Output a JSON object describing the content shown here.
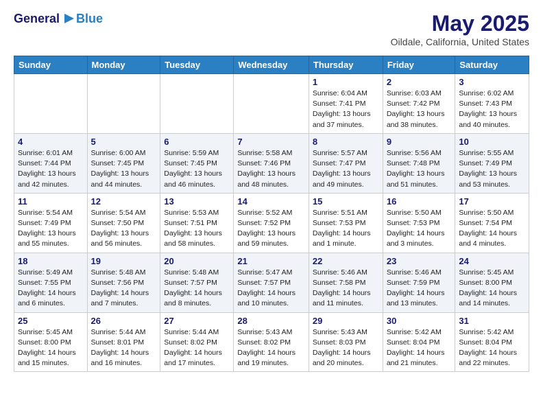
{
  "header": {
    "logo_general": "General",
    "logo_blue": "Blue",
    "month_title": "May 2025",
    "location": "Oildale, California, United States"
  },
  "weekdays": [
    "Sunday",
    "Monday",
    "Tuesday",
    "Wednesday",
    "Thursday",
    "Friday",
    "Saturday"
  ],
  "weeks": [
    [
      {
        "day": "",
        "sunrise": "",
        "sunset": "",
        "daylight": ""
      },
      {
        "day": "",
        "sunrise": "",
        "sunset": "",
        "daylight": ""
      },
      {
        "day": "",
        "sunrise": "",
        "sunset": "",
        "daylight": ""
      },
      {
        "day": "",
        "sunrise": "",
        "sunset": "",
        "daylight": ""
      },
      {
        "day": "1",
        "sunrise": "Sunrise: 6:04 AM",
        "sunset": "Sunset: 7:41 PM",
        "daylight": "Daylight: 13 hours and 37 minutes."
      },
      {
        "day": "2",
        "sunrise": "Sunrise: 6:03 AM",
        "sunset": "Sunset: 7:42 PM",
        "daylight": "Daylight: 13 hours and 38 minutes."
      },
      {
        "day": "3",
        "sunrise": "Sunrise: 6:02 AM",
        "sunset": "Sunset: 7:43 PM",
        "daylight": "Daylight: 13 hours and 40 minutes."
      }
    ],
    [
      {
        "day": "4",
        "sunrise": "Sunrise: 6:01 AM",
        "sunset": "Sunset: 7:44 PM",
        "daylight": "Daylight: 13 hours and 42 minutes."
      },
      {
        "day": "5",
        "sunrise": "Sunrise: 6:00 AM",
        "sunset": "Sunset: 7:45 PM",
        "daylight": "Daylight: 13 hours and 44 minutes."
      },
      {
        "day": "6",
        "sunrise": "Sunrise: 5:59 AM",
        "sunset": "Sunset: 7:45 PM",
        "daylight": "Daylight: 13 hours and 46 minutes."
      },
      {
        "day": "7",
        "sunrise": "Sunrise: 5:58 AM",
        "sunset": "Sunset: 7:46 PM",
        "daylight": "Daylight: 13 hours and 48 minutes."
      },
      {
        "day": "8",
        "sunrise": "Sunrise: 5:57 AM",
        "sunset": "Sunset: 7:47 PM",
        "daylight": "Daylight: 13 hours and 49 minutes."
      },
      {
        "day": "9",
        "sunrise": "Sunrise: 5:56 AM",
        "sunset": "Sunset: 7:48 PM",
        "daylight": "Daylight: 13 hours and 51 minutes."
      },
      {
        "day": "10",
        "sunrise": "Sunrise: 5:55 AM",
        "sunset": "Sunset: 7:49 PM",
        "daylight": "Daylight: 13 hours and 53 minutes."
      }
    ],
    [
      {
        "day": "11",
        "sunrise": "Sunrise: 5:54 AM",
        "sunset": "Sunset: 7:49 PM",
        "daylight": "Daylight: 13 hours and 55 minutes."
      },
      {
        "day": "12",
        "sunrise": "Sunrise: 5:54 AM",
        "sunset": "Sunset: 7:50 PM",
        "daylight": "Daylight: 13 hours and 56 minutes."
      },
      {
        "day": "13",
        "sunrise": "Sunrise: 5:53 AM",
        "sunset": "Sunset: 7:51 PM",
        "daylight": "Daylight: 13 hours and 58 minutes."
      },
      {
        "day": "14",
        "sunrise": "Sunrise: 5:52 AM",
        "sunset": "Sunset: 7:52 PM",
        "daylight": "Daylight: 13 hours and 59 minutes."
      },
      {
        "day": "15",
        "sunrise": "Sunrise: 5:51 AM",
        "sunset": "Sunset: 7:53 PM",
        "daylight": "Daylight: 14 hours and 1 minute."
      },
      {
        "day": "16",
        "sunrise": "Sunrise: 5:50 AM",
        "sunset": "Sunset: 7:53 PM",
        "daylight": "Daylight: 14 hours and 3 minutes."
      },
      {
        "day": "17",
        "sunrise": "Sunrise: 5:50 AM",
        "sunset": "Sunset: 7:54 PM",
        "daylight": "Daylight: 14 hours and 4 minutes."
      }
    ],
    [
      {
        "day": "18",
        "sunrise": "Sunrise: 5:49 AM",
        "sunset": "Sunset: 7:55 PM",
        "daylight": "Daylight: 14 hours and 6 minutes."
      },
      {
        "day": "19",
        "sunrise": "Sunrise: 5:48 AM",
        "sunset": "Sunset: 7:56 PM",
        "daylight": "Daylight: 14 hours and 7 minutes."
      },
      {
        "day": "20",
        "sunrise": "Sunrise: 5:48 AM",
        "sunset": "Sunset: 7:57 PM",
        "daylight": "Daylight: 14 hours and 8 minutes."
      },
      {
        "day": "21",
        "sunrise": "Sunrise: 5:47 AM",
        "sunset": "Sunset: 7:57 PM",
        "daylight": "Daylight: 14 hours and 10 minutes."
      },
      {
        "day": "22",
        "sunrise": "Sunrise: 5:46 AM",
        "sunset": "Sunset: 7:58 PM",
        "daylight": "Daylight: 14 hours and 11 minutes."
      },
      {
        "day": "23",
        "sunrise": "Sunrise: 5:46 AM",
        "sunset": "Sunset: 7:59 PM",
        "daylight": "Daylight: 14 hours and 13 minutes."
      },
      {
        "day": "24",
        "sunrise": "Sunrise: 5:45 AM",
        "sunset": "Sunset: 8:00 PM",
        "daylight": "Daylight: 14 hours and 14 minutes."
      }
    ],
    [
      {
        "day": "25",
        "sunrise": "Sunrise: 5:45 AM",
        "sunset": "Sunset: 8:00 PM",
        "daylight": "Daylight: 14 hours and 15 minutes."
      },
      {
        "day": "26",
        "sunrise": "Sunrise: 5:44 AM",
        "sunset": "Sunset: 8:01 PM",
        "daylight": "Daylight: 14 hours and 16 minutes."
      },
      {
        "day": "27",
        "sunrise": "Sunrise: 5:44 AM",
        "sunset": "Sunset: 8:02 PM",
        "daylight": "Daylight: 14 hours and 17 minutes."
      },
      {
        "day": "28",
        "sunrise": "Sunrise: 5:43 AM",
        "sunset": "Sunset: 8:02 PM",
        "daylight": "Daylight: 14 hours and 19 minutes."
      },
      {
        "day": "29",
        "sunrise": "Sunrise: 5:43 AM",
        "sunset": "Sunset: 8:03 PM",
        "daylight": "Daylight: 14 hours and 20 minutes."
      },
      {
        "day": "30",
        "sunrise": "Sunrise: 5:42 AM",
        "sunset": "Sunset: 8:04 PM",
        "daylight": "Daylight: 14 hours and 21 minutes."
      },
      {
        "day": "31",
        "sunrise": "Sunrise: 5:42 AM",
        "sunset": "Sunset: 8:04 PM",
        "daylight": "Daylight: 14 hours and 22 minutes."
      }
    ]
  ]
}
